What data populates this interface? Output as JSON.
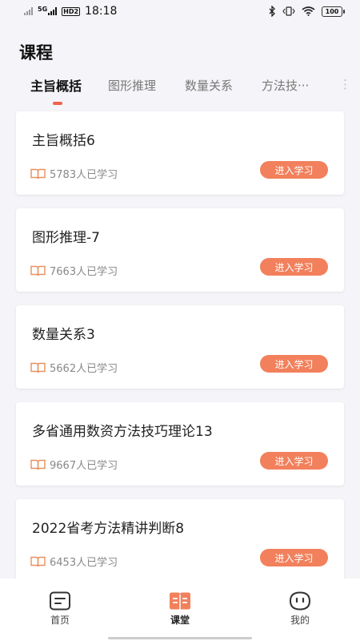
{
  "status_bar": {
    "net": "5G",
    "hd": "HD2",
    "time": "18:18",
    "battery": "100"
  },
  "header": {
    "title": "课程"
  },
  "tabs": [
    {
      "label": "主旨概括",
      "active": true
    },
    {
      "label": "图形推理",
      "active": false
    },
    {
      "label": "数量关系",
      "active": false
    },
    {
      "label": "方法技···",
      "active": false
    }
  ],
  "courses": [
    {
      "title": "主旨概括6",
      "learners": "5783人已学习",
      "button": "进入学习"
    },
    {
      "title": "图形推理-7",
      "learners": "7663人已学习",
      "button": "进入学习"
    },
    {
      "title": "数量关系3",
      "learners": "5662人已学习",
      "button": "进入学习"
    },
    {
      "title": "多省通用数资方法技巧理论13",
      "learners": "9667人已学习",
      "button": "进入学习"
    },
    {
      "title": "2022省考方法精讲判断8",
      "learners": "6453人已学习",
      "button": "进入学习"
    }
  ],
  "bottom_nav": [
    {
      "label": "首页",
      "icon": "home-icon"
    },
    {
      "label": "课堂",
      "icon": "classroom-icon",
      "active": true
    },
    {
      "label": "我的",
      "icon": "profile-icon"
    }
  ],
  "colors": {
    "accent": "#f0624f",
    "button": "#f2805c",
    "book_icon": "#e8905f"
  }
}
